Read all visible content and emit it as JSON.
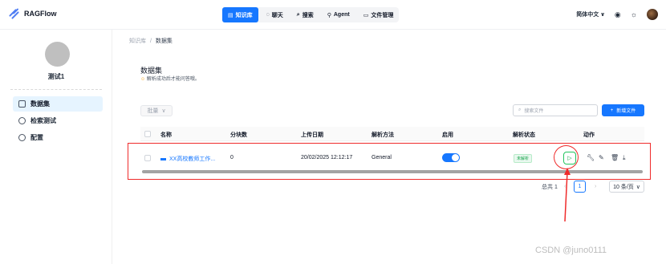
{
  "app": {
    "name": "RAGFlow",
    "accent": "#1677ff"
  },
  "nav": {
    "items": [
      {
        "label": "知识库",
        "icon": "database-icon",
        "active": true
      },
      {
        "label": "聊天",
        "icon": "chat-icon",
        "active": false
      },
      {
        "label": "搜索",
        "icon": "search-icon",
        "active": false
      },
      {
        "label": "Agent",
        "icon": "agent-icon",
        "active": false
      },
      {
        "label": "文件管理",
        "icon": "folder-icon",
        "active": false
      }
    ],
    "language": "简体中文"
  },
  "sidebar": {
    "kb_name": "测试1",
    "items": [
      {
        "label": "数据集",
        "icon": "file-icon",
        "active": true
      },
      {
        "label": "检索测试",
        "icon": "target-icon",
        "active": false
      },
      {
        "label": "配置",
        "icon": "gear-icon",
        "active": false
      }
    ]
  },
  "breadcrumb": {
    "root": "知识库",
    "sep": "/",
    "current": "数据集"
  },
  "header": {
    "title": "数据集",
    "subtitle": "解析成功后才能问答哦。"
  },
  "toolbar": {
    "batch_label": "批量",
    "search_placeholder": "搜索文件",
    "new_label": "新增文件"
  },
  "table": {
    "columns": [
      "名称",
      "分块数",
      "上传日期",
      "解析方法",
      "启用",
      "解析状态",
      "动作"
    ],
    "rows": [
      {
        "name": "XX高校教师工作...",
        "chunks": "0",
        "upload_date": "20/02/2025 12:12:17",
        "parser": "General",
        "enabled": true,
        "status": "未解析"
      }
    ]
  },
  "pagination": {
    "total": "总共 1",
    "current_page": "1",
    "page_size": "10 条/页"
  },
  "watermark": "CSDN @juno0111"
}
